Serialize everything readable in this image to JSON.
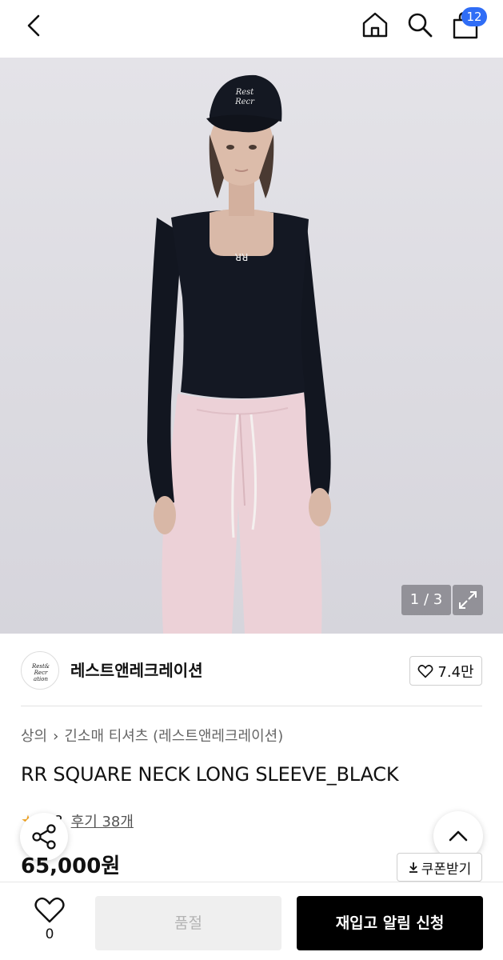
{
  "header": {
    "cart_count": "12"
  },
  "gallery": {
    "counter": "1 / 3"
  },
  "brand": {
    "name": "레스트앤레크레이션",
    "likes": "7.4만"
  },
  "breadcrumb": {
    "items": [
      "상의",
      "긴소매 티셔츠 (레스트앤레크레이션)"
    ]
  },
  "product": {
    "title": "RR SQUARE NECK LONG SLEEVE_BLACK",
    "score": "4.8",
    "reviews": "후기 38개",
    "price": "65,000원"
  },
  "coupon": {
    "label": "쿠폰받기"
  },
  "bottom": {
    "wish_count": "0",
    "soldout_label": "품절",
    "restock_label": "재입고 알림 신청"
  },
  "colors": {
    "accent": "#2f6df6",
    "primary_button": "#000000",
    "disabled_button": "#efefef"
  }
}
